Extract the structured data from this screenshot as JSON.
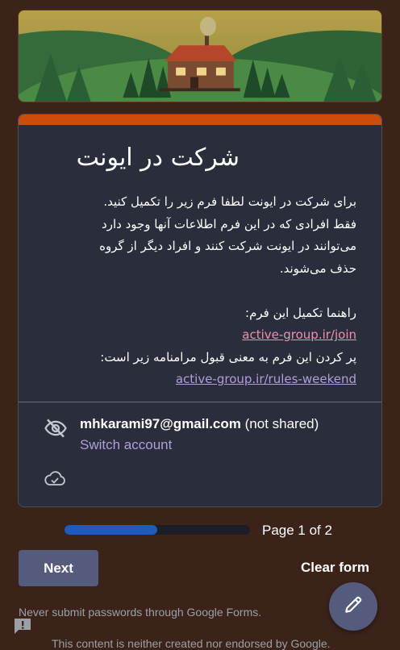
{
  "form": {
    "title": "شرکت در ایونت",
    "description": {
      "line1": "برای شرکت در ایونت لطفا فرم زیر را تکمیل کنید.",
      "line2": "فقط افرادی که در این فرم اطلاعات آنها وجود دارد",
      "line3": "می‌توانند در ایونت شرکت کنند و افراد دیگر از گروه",
      "line4": "حذف می‌شوند.",
      "guide_label": "راهنما تکمیل این فرم:",
      "guide_link": "active-group.ir/join",
      "rules_label": "پر کردن این فرم به معنی قبول مرامنامه زیر است:",
      "rules_link": "active-group.ir/rules-weekend"
    },
    "account": {
      "email": "mhkarami97@gmail.com",
      "shared_note": "(not shared)",
      "switch_label": "Switch account"
    }
  },
  "navigation": {
    "progress": 0.5,
    "page_label": "Page 1 of 2",
    "next_label": "Next",
    "clear_label": "Clear form"
  },
  "notices": {
    "password_warning": "Never submit passwords through Google Forms.",
    "footer": "This content is neither created nor endorsed by Google."
  },
  "icons": {
    "account": "eye-off-icon",
    "cloud": "cloud-check-icon",
    "fab": "pencil-icon",
    "report": "report-icon"
  },
  "colors": {
    "background": "#3b231a",
    "card": "#2a2d3b",
    "accent": "#cc4d0b",
    "button": "#555b7c",
    "progress": "#1e5bbd",
    "link_pink": "#f48fb1",
    "link_purple": "#b39ddb"
  }
}
